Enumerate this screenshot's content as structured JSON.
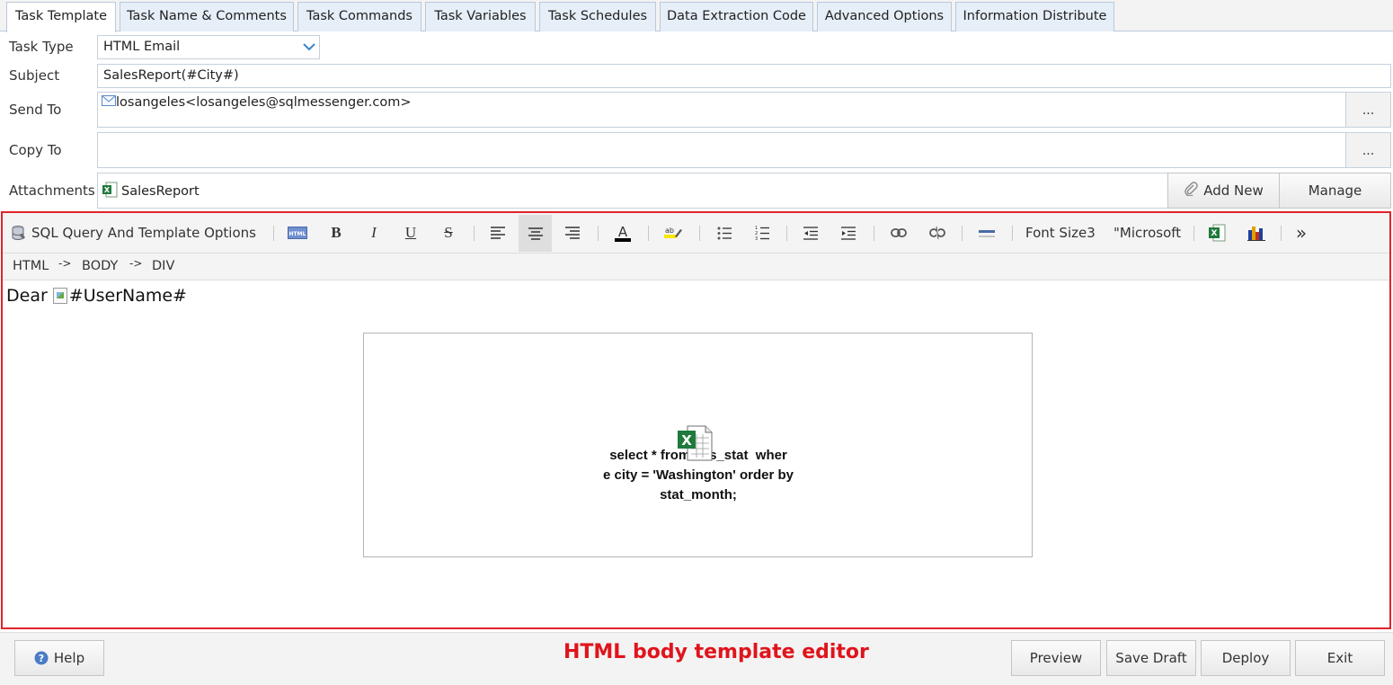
{
  "tabs": [
    {
      "label": "Task Template",
      "active": true
    },
    {
      "label": "Task Name & Comments",
      "active": false
    },
    {
      "label": "Task Commands",
      "active": false
    },
    {
      "label": "Task Variables",
      "active": false
    },
    {
      "label": "Task Schedules",
      "active": false
    },
    {
      "label": "Data Extraction Code",
      "active": false
    },
    {
      "label": "Advanced Options",
      "active": false
    },
    {
      "label": "Information Distribute",
      "active": false
    }
  ],
  "form": {
    "task_type_label": "Task Type",
    "task_type_value": "HTML Email",
    "subject_label": "Subject",
    "subject_value": "SalesReport(#City#)",
    "send_to_label": "Send To",
    "send_to_value": "losangeles<losangeles@sqlmessenger.com>",
    "copy_to_label": "Copy To",
    "copy_to_value": "",
    "browse_label": "...",
    "attachments_label": "Attachments",
    "attachment_name": "SalesReport",
    "add_new_label": "Add New",
    "manage_label": "Manage"
  },
  "toolbar": {
    "sql_options_label": "SQL Query And Template Options",
    "html_label": "HTML",
    "bold_label": "B",
    "italic_label": "I",
    "underline_label": "U",
    "strike_label": "S",
    "font_size_label": "Font Size3",
    "font_name_label": "\"Microsoft",
    "more_label": "»"
  },
  "path": {
    "items": [
      "HTML",
      "BODY",
      "DIV"
    ],
    "separator": "->"
  },
  "editor_content": {
    "dear_text": "Dear",
    "username_placeholder": "#UserName#",
    "query_line1": "select * from     s_stat  wher",
    "query_line2": "e city = 'Washington' order by",
    "query_line3": "stat_month;"
  },
  "bottom": {
    "help_label": "Help",
    "caption": "HTML body template editor",
    "preview_label": "Preview",
    "save_draft_label": "Save Draft",
    "deploy_label": "Deploy",
    "exit_label": "Exit"
  },
  "colors": {
    "highlight_border": "#e0242b",
    "caption": "#e0141c",
    "tab_bg": "#e6eef8",
    "excel_green": "#1f7a3c"
  }
}
